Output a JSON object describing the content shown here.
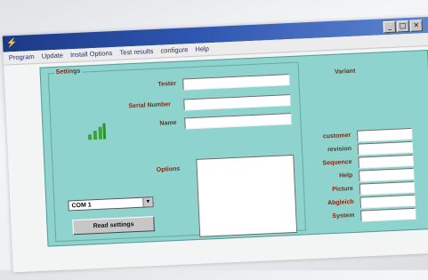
{
  "window": {
    "buttons": [
      "_",
      "□",
      "×"
    ]
  },
  "menu": [
    "Program",
    "Update",
    "Install Options",
    "Test results",
    "configure",
    "Help"
  ],
  "settings": {
    "group_label": "Settings",
    "tester_label": "Tester",
    "tester_value": "",
    "serial_label": "Serial Number",
    "serial_value": "",
    "name_label": "Name",
    "name_value": "",
    "options_label": "Options",
    "com_port": "COM 1",
    "read_button": "Read settings"
  },
  "variant": {
    "label": "Variant",
    "fields": [
      {
        "label": "customer",
        "value": ""
      },
      {
        "label": "revision",
        "value": ""
      },
      {
        "label": "Sequence",
        "value": ""
      },
      {
        "label": "Help",
        "value": ""
      },
      {
        "label": "Picture",
        "value": ""
      },
      {
        "label": "Abgleich",
        "value": ""
      },
      {
        "label": "System",
        "value": ""
      }
    ]
  },
  "colors": {
    "panel": "#8ed3ce",
    "label_text": "#7a2a14",
    "titlebar": "#1b3a86",
    "signal": "#3aa63a"
  }
}
